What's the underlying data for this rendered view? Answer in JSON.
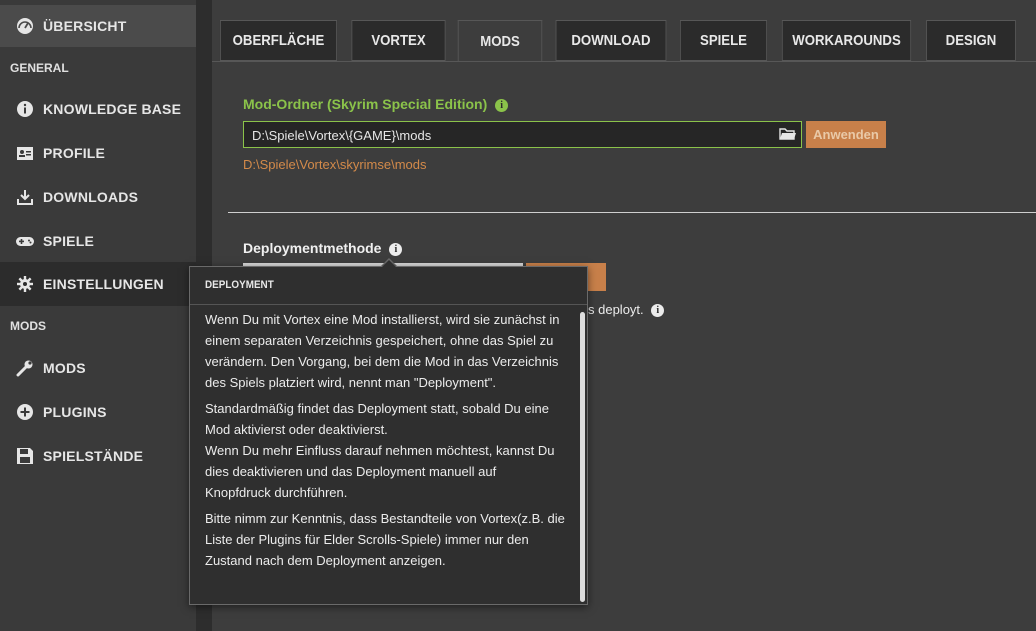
{
  "sidebar": {
    "overview": {
      "label": "ÜBERSICHT",
      "icon": "dashboard-icon"
    },
    "section_general": "GENERAL",
    "general_items": [
      {
        "label": "KNOWLEDGE BASE",
        "icon": "info-icon"
      },
      {
        "label": "PROFILE",
        "icon": "profile-card-icon"
      },
      {
        "label": "DOWNLOADS",
        "icon": "download-icon"
      },
      {
        "label": "SPIELE",
        "icon": "gamepad-icon"
      },
      {
        "label": "EINSTELLUNGEN",
        "icon": "gear-icon"
      }
    ],
    "section_mods": "MODS",
    "mods_items": [
      {
        "label": "MODS",
        "icon": "wrench-icon"
      },
      {
        "label": "PLUGINS",
        "icon": "plus-circle-icon"
      },
      {
        "label": "SPIELSTÄNDE",
        "icon": "floppy-icon"
      }
    ]
  },
  "tabs": [
    "OBERFLÄCHE",
    "VORTEX",
    "MODS",
    "DOWNLOAD",
    "SPIELE",
    "WORKAROUNDS",
    "DESIGN"
  ],
  "active_tab": "MODS",
  "mod_folder": {
    "label": "Mod-Ordner (Skyrim Special Edition)",
    "value": "D:\\Spiele\\Vortex\\{GAME}\\mods",
    "apply_label": "Anwenden",
    "resolved": "D:\\Spiele\\Vortex\\skyrimse\\mods"
  },
  "deployment": {
    "label": "Deploymentmethode",
    "note": "s deployt."
  },
  "tooltip": {
    "title": "DEPLOYMENT",
    "paragraphs": [
      "Wenn Du mit Vortex eine Mod installierst, wird sie zunächst in einem separaten Verzeichnis gespeichert, ohne das Spiel zu verändern. Den Vorgang, bei dem die Mod in das Verzeichnis des Spiels platziert wird, nennt man \"Deployment\".",
      "Standardmäßig findet das Deployment statt, sobald Du eine Mod aktivierst oder deaktivierst.",
      "Wenn Du mehr Einfluss darauf nehmen möchtest, kannst Du dies deaktivieren und das Deployment manuell auf Knopfdruck durchführen.",
      "Bitte nimm zur Kenntnis, dass Bestandteile von Vortex(z.B. die Liste der Plugins für Elder Scrolls-Spiele) immer nur den Zustand nach dem Deployment anzeigen."
    ]
  },
  "colors": {
    "accent_green": "#8bc34a",
    "accent_orange": "#c8804a",
    "path_orange": "#d38a4a"
  }
}
